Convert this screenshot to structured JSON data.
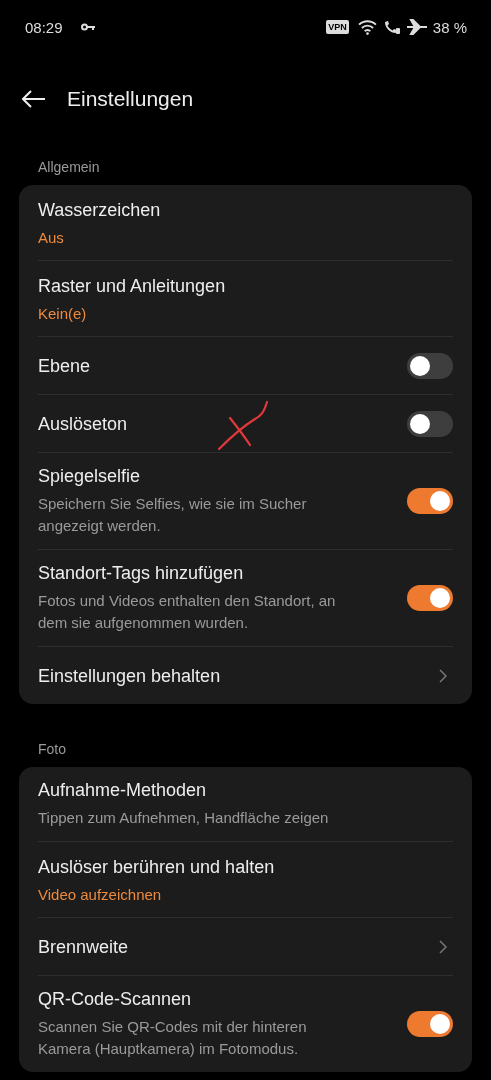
{
  "status_bar": {
    "time": "08:29",
    "vpn": "VPN",
    "battery": "38 %"
  },
  "header": {
    "title": "Einstellungen"
  },
  "sections": [
    {
      "title": "Allgemein",
      "items": [
        {
          "kind": "value",
          "title": "Wasserzeichen",
          "value": "Aus"
        },
        {
          "kind": "value",
          "title": "Raster und Anleitungen",
          "value": "Kein(e)"
        },
        {
          "kind": "toggle",
          "title": "Ebene",
          "on": false
        },
        {
          "kind": "toggle",
          "title": "Auslöseton",
          "on": false,
          "annotated": true
        },
        {
          "kind": "toggle",
          "title": "Spiegelselfie",
          "description": "Speichern Sie Selfies, wie sie im Sucher angezeigt werden.",
          "on": true
        },
        {
          "kind": "toggle",
          "title": "Standort-Tags hinzufügen",
          "description": "Fotos und Videos enthalten den Standort, an dem sie aufgenommen wurden.",
          "on": true
        },
        {
          "kind": "link",
          "title": "Einstellungen behalten"
        }
      ]
    },
    {
      "title": "Foto",
      "items": [
        {
          "kind": "info",
          "title": "Aufnahme-Methoden",
          "description": "Tippen zum Aufnehmen, Handfläche zeigen"
        },
        {
          "kind": "value",
          "title": "Auslöser berühren und halten",
          "value": "Video aufzeichnen"
        },
        {
          "kind": "link",
          "title": "Brennweite"
        },
        {
          "kind": "toggle",
          "title": "QR-Code-Scannen",
          "description": "Scannen Sie QR-Codes mit der hinteren Kamera (Hauptkamera) im Fotomodus.",
          "on": true
        }
      ]
    }
  ]
}
